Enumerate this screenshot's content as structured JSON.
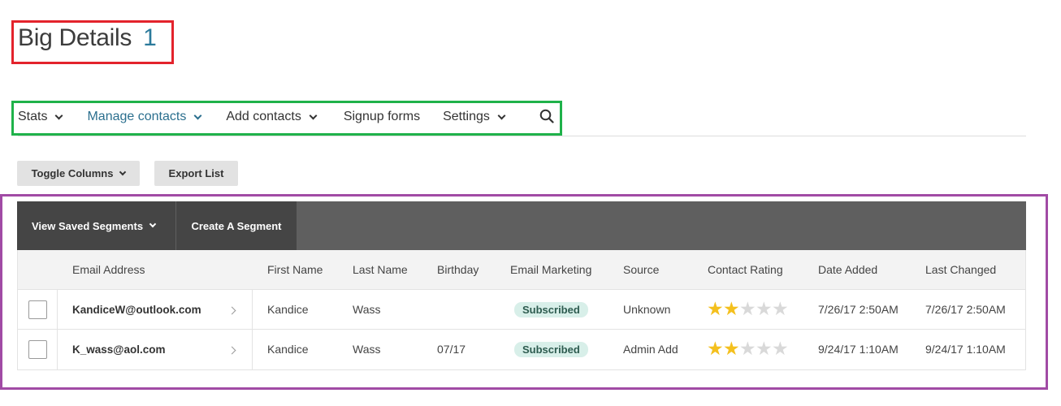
{
  "page": {
    "title": "Big Details",
    "count": "1"
  },
  "nav": {
    "items": [
      {
        "label": "Stats",
        "has_dropdown": true
      },
      {
        "label": "Manage contacts",
        "has_dropdown": true,
        "active": true
      },
      {
        "label": "Add contacts",
        "has_dropdown": true
      },
      {
        "label": "Signup forms",
        "has_dropdown": false
      },
      {
        "label": "Settings",
        "has_dropdown": true
      }
    ],
    "search_icon": "search-icon"
  },
  "toolbar": {
    "toggle_columns": "Toggle Columns",
    "export_list": "Export List"
  },
  "segments": {
    "view_saved": "View Saved Segments",
    "create": "Create A Segment"
  },
  "table": {
    "columns": [
      "Email Address",
      "First Name",
      "Last Name",
      "Birthday",
      "Email Marketing",
      "Source",
      "Contact Rating",
      "Date Added",
      "Last Changed"
    ],
    "rows": [
      {
        "email": "KandiceW@outlook.com",
        "first_name": "Kandice",
        "last_name": "Wass",
        "birthday": "",
        "email_marketing": "Subscribed",
        "source": "Unknown",
        "rating": 2,
        "rating_max": 5,
        "date_added": "7/26/17 2:50AM",
        "last_changed": "7/26/17 2:50AM"
      },
      {
        "email": "K_wass@aol.com",
        "first_name": "Kandice",
        "last_name": "Wass",
        "birthday": "07/17",
        "email_marketing": "Subscribed",
        "source": "Admin Add",
        "rating": 2,
        "rating_max": 5,
        "date_added": "9/24/17 1:10AM",
        "last_changed": "9/24/17 1:10AM"
      }
    ]
  },
  "colors": {
    "title_count": "#2b7a9b",
    "nav_active": "#2b6f8e",
    "star_filled": "#f4c01e",
    "star_empty": "#d9d9d9",
    "badge_bg": "#d8efe9",
    "segment_bar": "#5f5f5f",
    "annotation_red": "#e3232c",
    "annotation_green": "#1fb24a",
    "annotation_purple": "#a14ba5"
  }
}
